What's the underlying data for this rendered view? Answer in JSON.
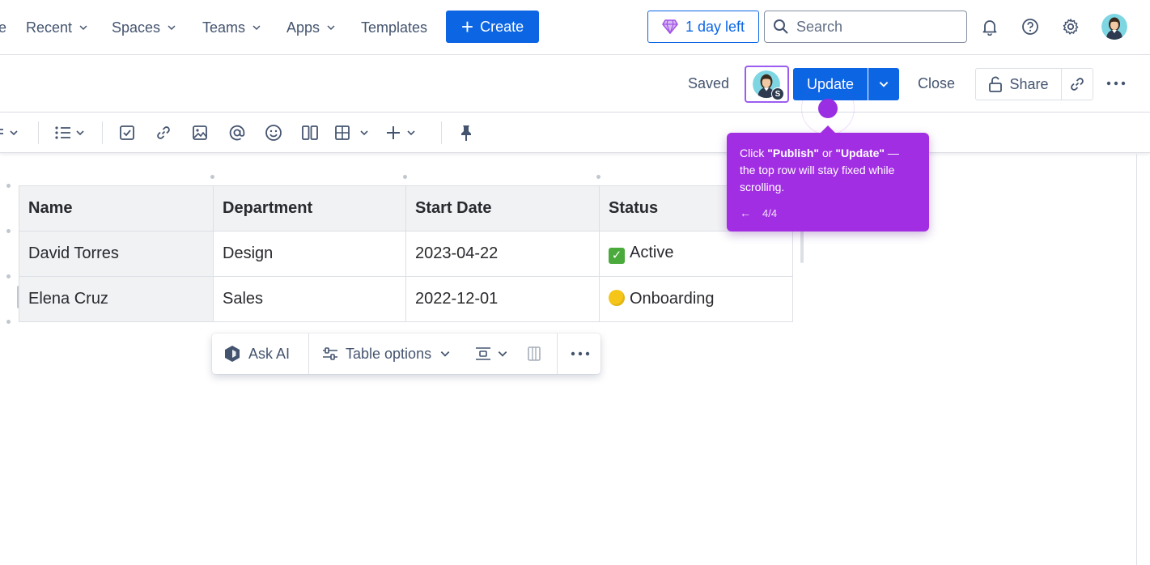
{
  "nav": {
    "partial_left": "e",
    "recent": "Recent",
    "spaces": "Spaces",
    "teams": "Teams",
    "apps": "Apps",
    "templates": "Templates",
    "create": "Create",
    "trial": "1 day left",
    "search_placeholder": "Search"
  },
  "actions": {
    "saved": "Saved",
    "collaborator_badge": "S",
    "update": "Update",
    "close": "Close",
    "share": "Share"
  },
  "table": {
    "headers": [
      "Name",
      "Department",
      "Start Date",
      "Status"
    ],
    "rows": [
      [
        "David Torres",
        "Design",
        "2023-04-22",
        "Active"
      ],
      [
        "Elena Cruz",
        "Sales",
        "2022-12-01",
        "Onboarding"
      ]
    ]
  },
  "floatbar": {
    "ask_ai": "Ask AI",
    "table_options": "Table options"
  },
  "tooltip": {
    "t1": "Click ",
    "publish": "\"Publish\"",
    "or": " or ",
    "update": "\"Update\"",
    "t2": " — the top row will stay fixed while scrolling.",
    "step": "4/4"
  },
  "colors": {
    "primary": "#0c66e4",
    "guide": "#a22ee3",
    "highlight": "#9c5cf0"
  }
}
